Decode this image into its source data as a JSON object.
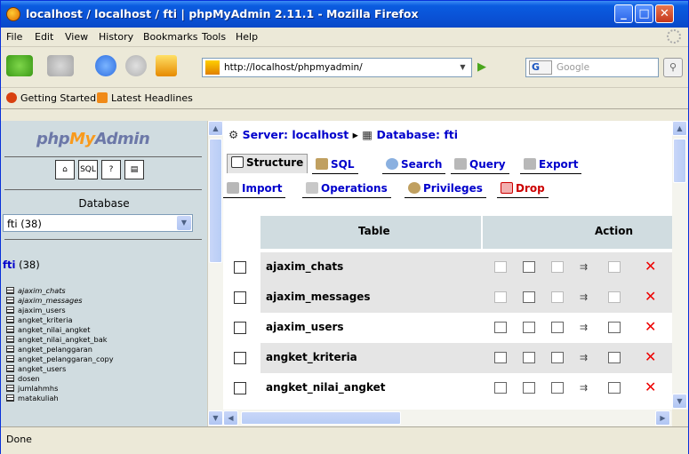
{
  "window": {
    "title": "localhost / localhost / fti | phpMyAdmin 2.11.1 - Mozilla Firefox",
    "minimize": "_",
    "maximize": "□",
    "close": "✕"
  },
  "menu": [
    "File",
    "Edit",
    "View",
    "History",
    "Bookmarks",
    "Tools",
    "Help"
  ],
  "nav": {
    "url": "http://localhost/phpmyadmin/",
    "search_engine": "G",
    "search_placeholder": "Google"
  },
  "bookmarks": [
    "Getting Started",
    "Latest Headlines"
  ],
  "left": {
    "logo_php": "php",
    "logo_my": "My",
    "logo_admin": "Admin",
    "database_label": "Database",
    "db_select": "fti (38)",
    "db_name": "fti",
    "db_count": " (38)",
    "tables": [
      "ajaxim_chats",
      "ajaxim_messages",
      "ajaxim_users",
      "angket_kriteria",
      "angket_nilai_angket",
      "angket_nilai_angket_bak",
      "angket_pelanggaran",
      "angket_pelanggaran_copy",
      "angket_users",
      "dosen",
      "jumlahmhs",
      "matakuliah"
    ]
  },
  "main": {
    "server_label": "Server: localhost",
    "sep": "▸",
    "database_label": "Database: fti",
    "tabs": {
      "structure": "Structure",
      "sql": "SQL",
      "search": "Search",
      "query": "Query",
      "export": "Export",
      "import": "Import",
      "operations": "Operations",
      "privileges": "Privileges",
      "drop": "Drop"
    },
    "table_header": "Table",
    "action_header": "Action",
    "rows": [
      {
        "name": "ajaxim_chats",
        "shaded": true,
        "browse_enabled": false
      },
      {
        "name": "ajaxim_messages",
        "shaded": true,
        "browse_enabled": false
      },
      {
        "name": "ajaxim_users",
        "shaded": false,
        "browse_enabled": true
      },
      {
        "name": "angket_kriteria",
        "shaded": true,
        "browse_enabled": true
      },
      {
        "name": "angket_nilai_angket",
        "shaded": false,
        "browse_enabled": true
      }
    ]
  },
  "status": "Done",
  "colors": {
    "title_bar": "#0a52d6",
    "left_panel": "#d0dce0",
    "row_shade": "#e5e5e5",
    "link": "#0000cc",
    "drop": "#cc0000"
  }
}
